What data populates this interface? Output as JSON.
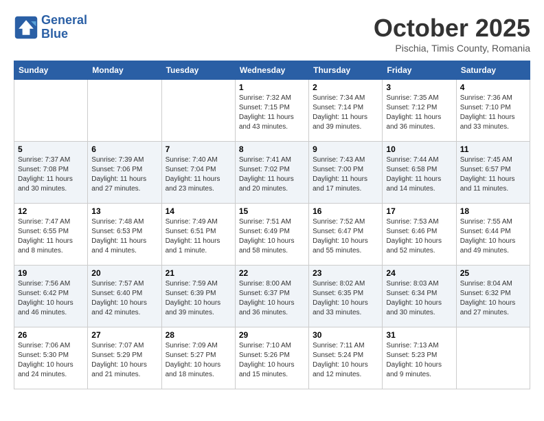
{
  "logo": {
    "line1": "General",
    "line2": "Blue"
  },
  "title": "October 2025",
  "subtitle": "Pischia, Timis County, Romania",
  "weekdays": [
    "Sunday",
    "Monday",
    "Tuesday",
    "Wednesday",
    "Thursday",
    "Friday",
    "Saturday"
  ],
  "weeks": [
    [
      {
        "day": "",
        "info": ""
      },
      {
        "day": "",
        "info": ""
      },
      {
        "day": "",
        "info": ""
      },
      {
        "day": "1",
        "info": "Sunrise: 7:32 AM\nSunset: 7:15 PM\nDaylight: 11 hours\nand 43 minutes."
      },
      {
        "day": "2",
        "info": "Sunrise: 7:34 AM\nSunset: 7:14 PM\nDaylight: 11 hours\nand 39 minutes."
      },
      {
        "day": "3",
        "info": "Sunrise: 7:35 AM\nSunset: 7:12 PM\nDaylight: 11 hours\nand 36 minutes."
      },
      {
        "day": "4",
        "info": "Sunrise: 7:36 AM\nSunset: 7:10 PM\nDaylight: 11 hours\nand 33 minutes."
      }
    ],
    [
      {
        "day": "5",
        "info": "Sunrise: 7:37 AM\nSunset: 7:08 PM\nDaylight: 11 hours\nand 30 minutes."
      },
      {
        "day": "6",
        "info": "Sunrise: 7:39 AM\nSunset: 7:06 PM\nDaylight: 11 hours\nand 27 minutes."
      },
      {
        "day": "7",
        "info": "Sunrise: 7:40 AM\nSunset: 7:04 PM\nDaylight: 11 hours\nand 23 minutes."
      },
      {
        "day": "8",
        "info": "Sunrise: 7:41 AM\nSunset: 7:02 PM\nDaylight: 11 hours\nand 20 minutes."
      },
      {
        "day": "9",
        "info": "Sunrise: 7:43 AM\nSunset: 7:00 PM\nDaylight: 11 hours\nand 17 minutes."
      },
      {
        "day": "10",
        "info": "Sunrise: 7:44 AM\nSunset: 6:58 PM\nDaylight: 11 hours\nand 14 minutes."
      },
      {
        "day": "11",
        "info": "Sunrise: 7:45 AM\nSunset: 6:57 PM\nDaylight: 11 hours\nand 11 minutes."
      }
    ],
    [
      {
        "day": "12",
        "info": "Sunrise: 7:47 AM\nSunset: 6:55 PM\nDaylight: 11 hours\nand 8 minutes."
      },
      {
        "day": "13",
        "info": "Sunrise: 7:48 AM\nSunset: 6:53 PM\nDaylight: 11 hours\nand 4 minutes."
      },
      {
        "day": "14",
        "info": "Sunrise: 7:49 AM\nSunset: 6:51 PM\nDaylight: 11 hours\nand 1 minute."
      },
      {
        "day": "15",
        "info": "Sunrise: 7:51 AM\nSunset: 6:49 PM\nDaylight: 10 hours\nand 58 minutes."
      },
      {
        "day": "16",
        "info": "Sunrise: 7:52 AM\nSunset: 6:47 PM\nDaylight: 10 hours\nand 55 minutes."
      },
      {
        "day": "17",
        "info": "Sunrise: 7:53 AM\nSunset: 6:46 PM\nDaylight: 10 hours\nand 52 minutes."
      },
      {
        "day": "18",
        "info": "Sunrise: 7:55 AM\nSunset: 6:44 PM\nDaylight: 10 hours\nand 49 minutes."
      }
    ],
    [
      {
        "day": "19",
        "info": "Sunrise: 7:56 AM\nSunset: 6:42 PM\nDaylight: 10 hours\nand 46 minutes."
      },
      {
        "day": "20",
        "info": "Sunrise: 7:57 AM\nSunset: 6:40 PM\nDaylight: 10 hours\nand 42 minutes."
      },
      {
        "day": "21",
        "info": "Sunrise: 7:59 AM\nSunset: 6:39 PM\nDaylight: 10 hours\nand 39 minutes."
      },
      {
        "day": "22",
        "info": "Sunrise: 8:00 AM\nSunset: 6:37 PM\nDaylight: 10 hours\nand 36 minutes."
      },
      {
        "day": "23",
        "info": "Sunrise: 8:02 AM\nSunset: 6:35 PM\nDaylight: 10 hours\nand 33 minutes."
      },
      {
        "day": "24",
        "info": "Sunrise: 8:03 AM\nSunset: 6:34 PM\nDaylight: 10 hours\nand 30 minutes."
      },
      {
        "day": "25",
        "info": "Sunrise: 8:04 AM\nSunset: 6:32 PM\nDaylight: 10 hours\nand 27 minutes."
      }
    ],
    [
      {
        "day": "26",
        "info": "Sunrise: 7:06 AM\nSunset: 5:30 PM\nDaylight: 10 hours\nand 24 minutes."
      },
      {
        "day": "27",
        "info": "Sunrise: 7:07 AM\nSunset: 5:29 PM\nDaylight: 10 hours\nand 21 minutes."
      },
      {
        "day": "28",
        "info": "Sunrise: 7:09 AM\nSunset: 5:27 PM\nDaylight: 10 hours\nand 18 minutes."
      },
      {
        "day": "29",
        "info": "Sunrise: 7:10 AM\nSunset: 5:26 PM\nDaylight: 10 hours\nand 15 minutes."
      },
      {
        "day": "30",
        "info": "Sunrise: 7:11 AM\nSunset: 5:24 PM\nDaylight: 10 hours\nand 12 minutes."
      },
      {
        "day": "31",
        "info": "Sunrise: 7:13 AM\nSunset: 5:23 PM\nDaylight: 10 hours\nand 9 minutes."
      },
      {
        "day": "",
        "info": ""
      }
    ]
  ]
}
